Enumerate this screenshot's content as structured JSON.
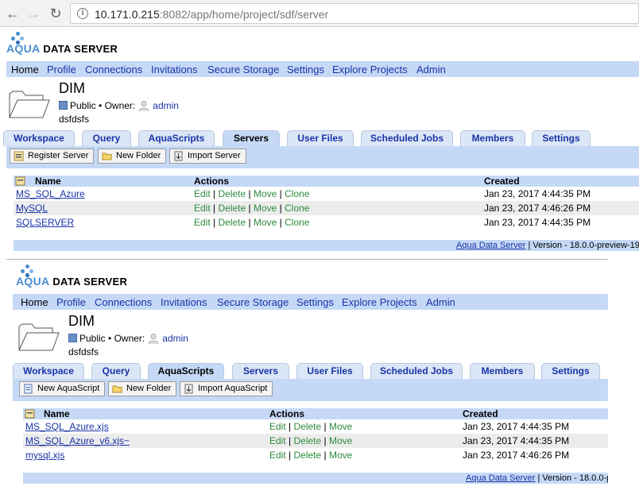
{
  "browser": {
    "url_host": "10.171.0.215",
    "url_rest": ":8082/app/home/project/sdf/server"
  },
  "logo": {
    "aqua": "AQUA",
    "rest": "DATA SERVER"
  },
  "menu": [
    "Home",
    "Profile",
    "Connections",
    "Invitations",
    "Secure Storage",
    "Settings",
    "Explore Projects",
    "Admin"
  ],
  "project": {
    "name": "DIM",
    "visibility": "Public",
    "bullet": "•",
    "owner_label": "Owner:",
    "owner": "admin",
    "description": "dsfdsfs"
  },
  "tabs": [
    "Workspace",
    "Query",
    "AquaScripts",
    "Servers",
    "User Files",
    "Scheduled Jobs",
    "Members",
    "Settings"
  ],
  "panel1": {
    "active_tab": "Servers",
    "toolbar": [
      "Register Server",
      "New Folder",
      "Import Server"
    ],
    "columns": [
      "Name",
      "Actions",
      "Created"
    ],
    "rows": [
      {
        "name": "MS_SQL_Azure",
        "created": "Jan 23, 2017 4:44:35 PM"
      },
      {
        "name": "MySQL",
        "created": "Jan 23, 2017 4:46:26 PM"
      },
      {
        "name": "SQLSERVER",
        "created": "Jan 23, 2017 4:44:35 PM"
      }
    ],
    "actions": [
      "Edit",
      "Delete",
      "Move",
      "Clone"
    ],
    "footer_link": "Aqua Data Server",
    "footer_text": " | Version - 18.0.0-preview-19"
  },
  "panel2": {
    "active_tab": "AquaScripts",
    "toolbar": [
      "New AquaScript",
      "New Folder",
      "Import AquaScript"
    ],
    "columns": [
      "Name",
      "Actions",
      "Created"
    ],
    "rows": [
      {
        "name": "MS_SQL_Azure.xjs",
        "created": "Jan 23, 2017 4:44:35 PM"
      },
      {
        "name": "MS_SQL_Azure_v6.xjs~",
        "created": "Jan 23, 2017 4:44:35 PM"
      },
      {
        "name": "mysql.xjs",
        "created": "Jan 23, 2017 4:46:26 PM"
      }
    ],
    "actions": [
      "Edit",
      "Delete",
      "Move"
    ],
    "footer_link": "Aqua Data Server",
    "footer_text": " | Version - 18.0.0-p"
  },
  "colors": {
    "bar": "#c5d9f6",
    "link": "#1a33a8",
    "action": "#2e8b3c",
    "aqua": "#4a8ed0"
  }
}
